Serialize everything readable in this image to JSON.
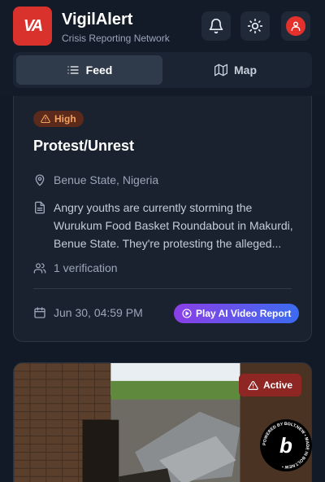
{
  "app": {
    "logo_text": "VA",
    "title": "VigilAlert",
    "subtitle": "Crisis Reporting Network"
  },
  "header": {
    "icons": [
      "bell-icon",
      "sun-icon",
      "user-icon"
    ]
  },
  "tabs": [
    {
      "label": "Feed",
      "icon": "list-icon",
      "active": true
    },
    {
      "label": "Map",
      "icon": "map-icon",
      "active": false
    }
  ],
  "report": {
    "severity": "High",
    "title": "Protest/Unrest",
    "location": "Benue State, Nigeria",
    "description_lines": [
      "Angry youths are currently storming the",
      "Wurukum Food Basket Roundabout in Makurdi,",
      "Benue State. They're protesting the alleged..."
    ],
    "verifications": "1 verification",
    "date": "Jun 30, 04:59 PM",
    "video_button": "Play AI Video Report"
  },
  "report2": {
    "status": "Active"
  },
  "badge": {
    "ring_text": "POWERED BY BOLT.NEW • MADE IN BOLT.NEW • ",
    "letter": "b"
  },
  "colors": {
    "brand": "#d9312b",
    "high": "#f4a261",
    "active_bg": "#8e2624",
    "play_gradient_start": "#8b3fe6",
    "play_gradient_end": "#3b6bf0"
  }
}
